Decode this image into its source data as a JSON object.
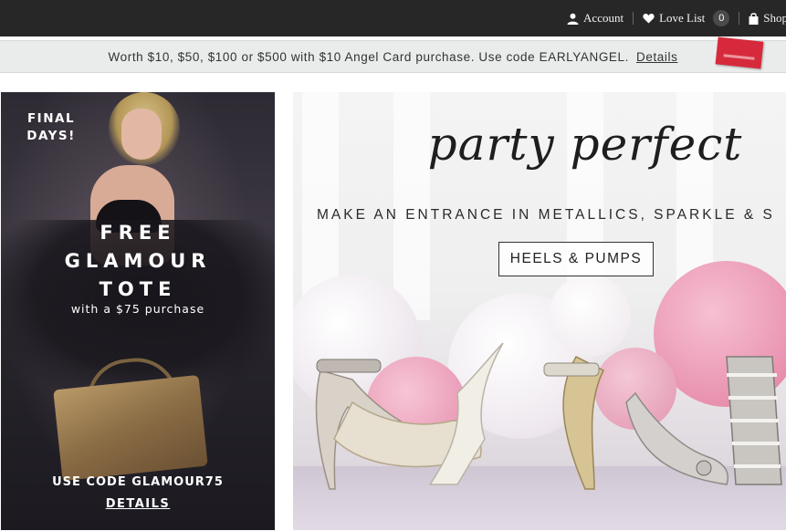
{
  "topnav": {
    "account_label": "Account",
    "lovelist_label": "Love List",
    "lovelist_count": "0",
    "shop_label": "Shop"
  },
  "promo": {
    "text": "Worth $10, $50, $100 or $500 with $10 Angel Card purchase. Use code EARLYANGEL.",
    "details_label": "Details"
  },
  "left_banner": {
    "final_days": "FINAL DAYS!",
    "title_line1": "FREE",
    "title_line2": "GLAMOUR",
    "title_line3": "TOTE",
    "subtitle": "with a $75 purchase",
    "code_text": "USE CODE GLAMOUR75",
    "details_label": "DETAILS"
  },
  "right_banner": {
    "title": "party perfect",
    "subtitle": "MAKE AN ENTRANCE IN METALLICS, SPARKLE & S",
    "cta_label": "HEELS & PUMPS"
  },
  "colors": {
    "topbar_bg": "#272727",
    "promo_bg": "#e9eceb",
    "balloon_pink": "#e99ab6",
    "balloon_white": "#f3eef2"
  }
}
